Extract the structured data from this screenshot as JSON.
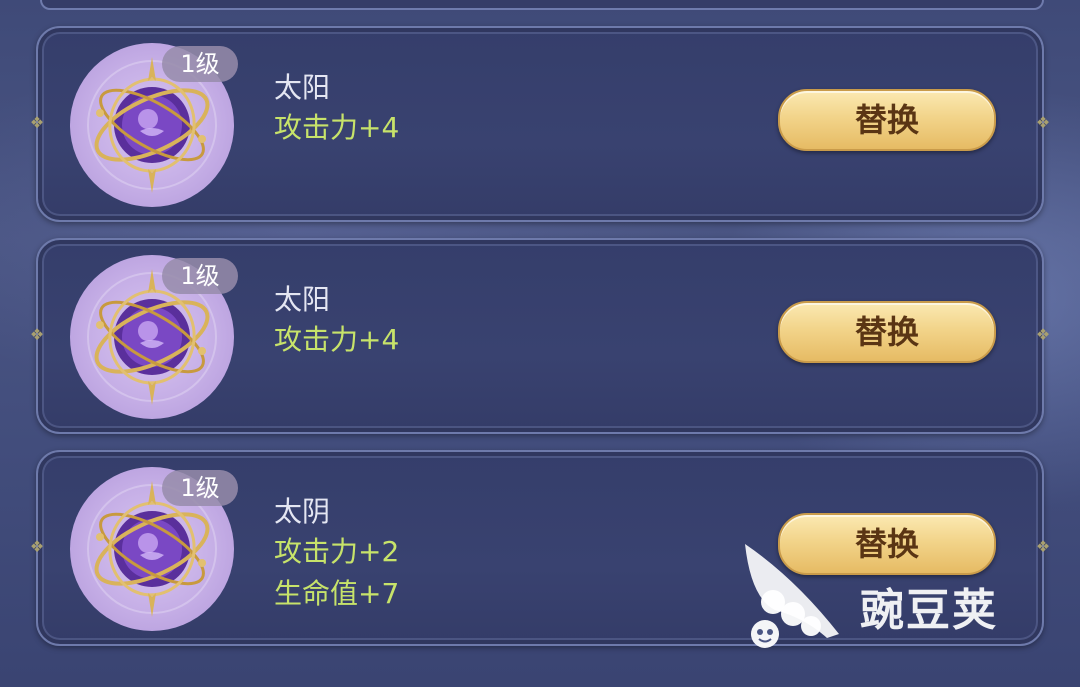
{
  "cards": [
    {
      "level": "1级",
      "name": "太阳",
      "stats": [
        "攻击力+4"
      ],
      "button_label": "替换"
    },
    {
      "level": "1级",
      "name": "太阳",
      "stats": [
        "攻击力+4"
      ],
      "button_label": "替换"
    },
    {
      "level": "1级",
      "name": "太阴",
      "stats": [
        "攻击力+2",
        "生命值+7"
      ],
      "button_label": "替换"
    }
  ],
  "watermark": {
    "text": "豌豆荚"
  },
  "colors": {
    "stat_text": "#c7e36a",
    "button_gold": "#f2d48a",
    "card_bg": "#373f6c"
  },
  "icons": {
    "item_icon": "astrolabe-orb-icon",
    "watermark_logo": "pea-pod-icon"
  }
}
